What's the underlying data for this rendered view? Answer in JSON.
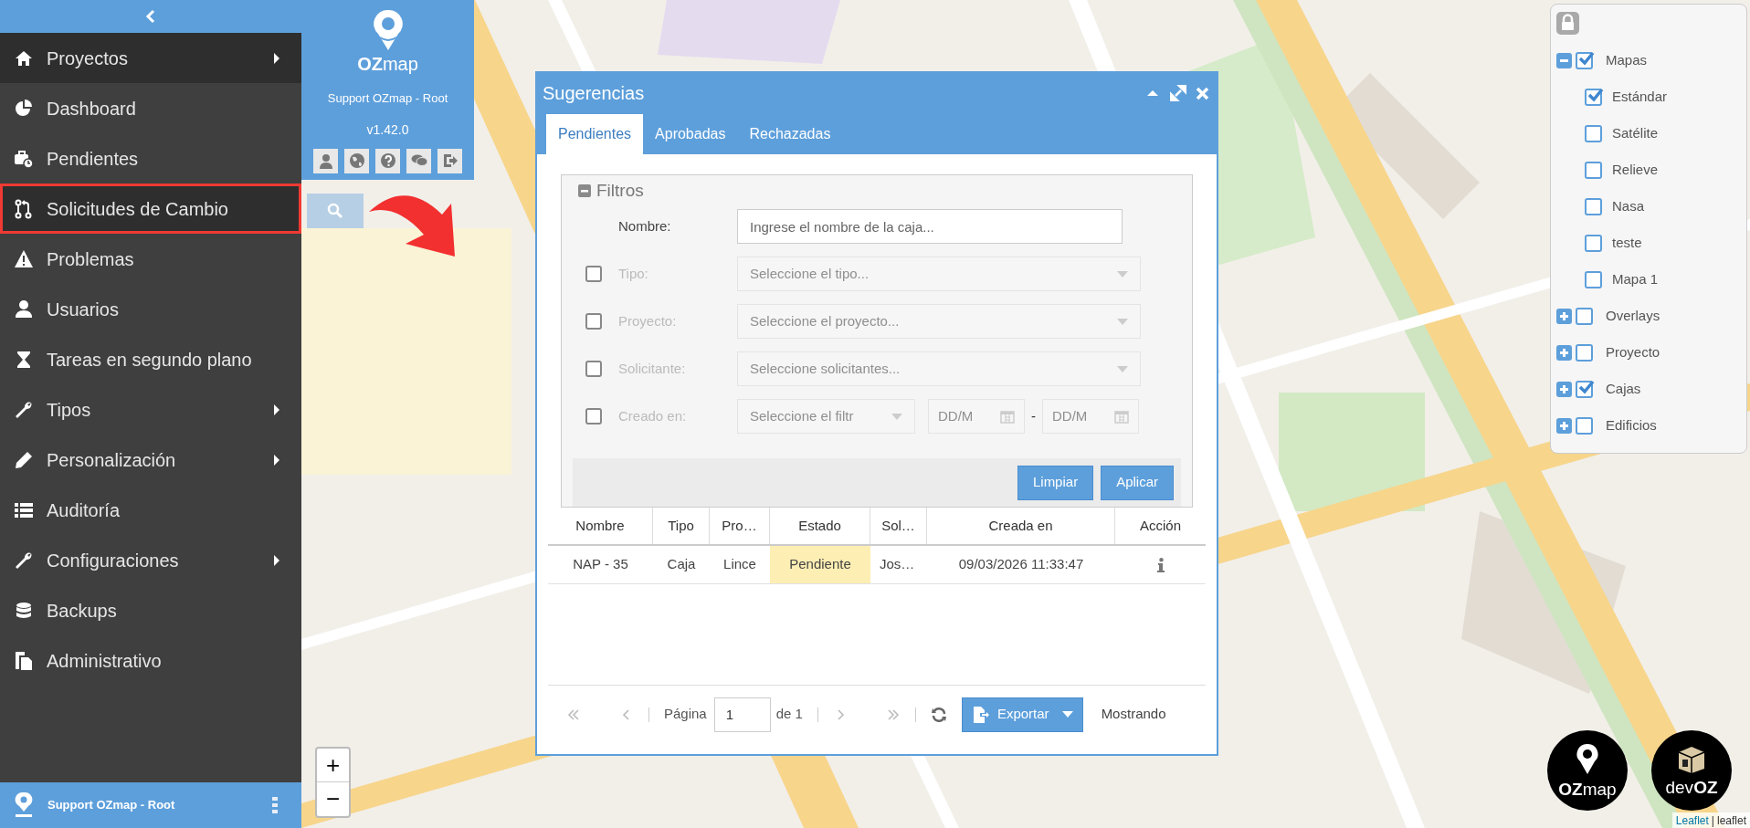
{
  "sidebar": {
    "items": [
      {
        "label": "Proyectos",
        "submenu": true,
        "selected": true,
        "highlighted": false
      },
      {
        "label": "Dashboard",
        "submenu": false,
        "selected": false,
        "highlighted": false
      },
      {
        "label": "Pendientes",
        "submenu": false,
        "selected": false,
        "highlighted": false
      },
      {
        "label": "Solicitudes de Cambio",
        "submenu": false,
        "selected": true,
        "highlighted": true
      },
      {
        "label": "Problemas",
        "submenu": false,
        "selected": false,
        "highlighted": false
      },
      {
        "label": "Usuarios",
        "submenu": false,
        "selected": false,
        "highlighted": false
      },
      {
        "label": "Tareas en segundo plano",
        "submenu": false,
        "selected": false,
        "highlighted": false
      },
      {
        "label": "Tipos",
        "submenu": true,
        "selected": false,
        "highlighted": false
      },
      {
        "label": "Personalización",
        "submenu": true,
        "selected": false,
        "highlighted": false
      },
      {
        "label": "Auditoría",
        "submenu": false,
        "selected": false,
        "highlighted": false
      },
      {
        "label": "Configuraciones",
        "submenu": true,
        "selected": false,
        "highlighted": false
      },
      {
        "label": "Backups",
        "submenu": false,
        "selected": false,
        "highlighted": false
      },
      {
        "label": "Administrativo",
        "submenu": false,
        "selected": false,
        "highlighted": false
      }
    ],
    "footer": {
      "user": "Support OZmap - Root"
    }
  },
  "brand": {
    "logo": "**OZ**map",
    "user": "Support OZmap - Root",
    "version": "v1.42.0"
  },
  "dialog": {
    "title": "Sugerencias",
    "tabs": [
      {
        "label": "Pendientes",
        "selected": true
      },
      {
        "label": "Aprobadas",
        "selected": false
      },
      {
        "label": "Rechazadas",
        "selected": false
      }
    ],
    "filters": {
      "legend": "Filtros",
      "expanded": true,
      "fields": [
        {
          "kind": "text",
          "label": "Nombre:",
          "placeholder": "Ingrese el nombre de la caja..."
        },
        {
          "kind": "select",
          "label": "Tipo:",
          "placeholder": "Seleccione el tipo...",
          "checked": false
        },
        {
          "kind": "select",
          "label": "Proyecto:",
          "placeholder": "Seleccione el proyecto...",
          "checked": false
        },
        {
          "kind": "select",
          "label": "Solicitante:",
          "placeholder": "Seleccione solicitantes...",
          "checked": false
        },
        {
          "kind": "date",
          "label": "Creado en:",
          "placeholder": "Seleccione el filtr",
          "checked": false,
          "from": "DD/M",
          "separator": "-",
          "to": "DD/M"
        }
      ],
      "buttons": [
        "Limpiar",
        "Aplicar"
      ]
    },
    "table": {
      "columns": [
        "Nombre",
        "Tipo",
        "Pro…",
        "Estado",
        "Sol…",
        "Creada en",
        "Acción"
      ],
      "rows": [
        {
          "cells": [
            {
              "text": "NAP - 35",
              "highlighted": false
            },
            {
              "text": "Caja",
              "highlighted": false
            },
            {
              "text": "Lince",
              "highlighted": false
            },
            {
              "text": "Pendiente",
              "highlighted": true
            },
            {
              "text": "Jos…",
              "highlighted": false
            },
            {
              "text": "09/03/2026 11:33:47",
              "highlighted": false
            }
          ]
        }
      ]
    },
    "pagination": {
      "page_label": "Página",
      "page": "1",
      "of": "de 1",
      "export": "Exportar",
      "summary": "Mostrando"
    }
  },
  "layers": {
    "items": [
      {
        "label": "Mapas",
        "checked": true,
        "expanded": true,
        "children": [
          {
            "label": "Estándar",
            "checked": true
          },
          {
            "label": "Satélite",
            "checked": false
          },
          {
            "label": "Relieve",
            "checked": false
          },
          {
            "label": "Nasa",
            "checked": false
          },
          {
            "label": "teste",
            "checked": false
          },
          {
            "label": "Mapa 1",
            "checked": false
          }
        ]
      },
      {
        "label": "Overlays",
        "checked": false,
        "expanded": false
      },
      {
        "label": "Proyecto",
        "checked": false,
        "expanded": false
      },
      {
        "label": "Cajas",
        "checked": true,
        "expanded": false
      },
      {
        "label": "Edificios",
        "checked": false,
        "expanded": false
      }
    ]
  },
  "map": {
    "zoom": [
      "+",
      "−"
    ],
    "badges": [
      {
        "kind": "ozmap",
        "text": "**OZ**map"
      },
      {
        "kind": "devoz",
        "text": "dev**OZ**"
      }
    ],
    "attribution": {
      "link": "Leaflet",
      "separator": "|",
      "source": "leaflet"
    }
  }
}
